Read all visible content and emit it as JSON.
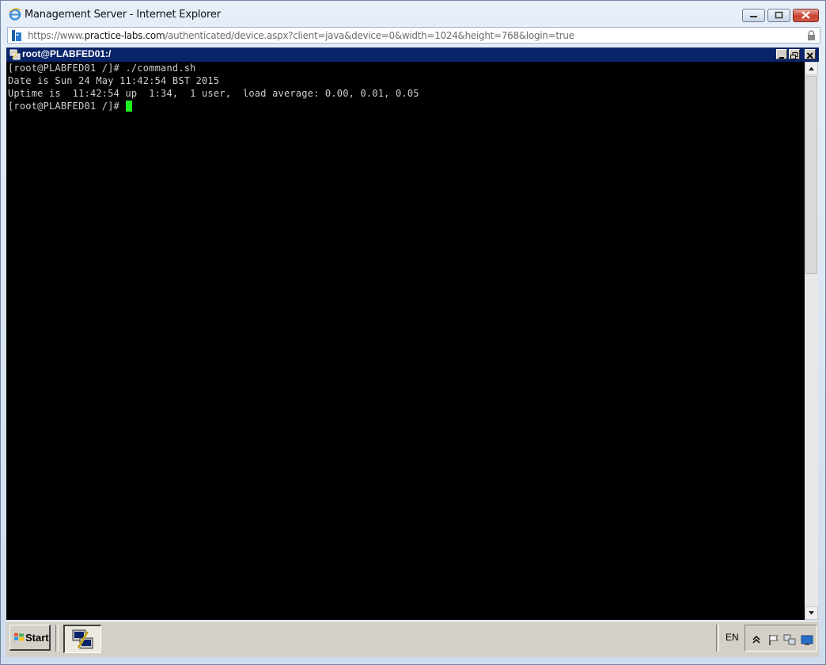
{
  "browser": {
    "title": "Management Server - Internet Explorer",
    "url_scheme": "https://www.",
    "url_host": "practice-labs.com",
    "url_path": "/authenticated/device.aspx?client=java&device=0&width=1024&height=768&login=true"
  },
  "remote_window": {
    "title": "root@PLABFED01:/"
  },
  "terminal": {
    "lines": [
      "[root@PLABFED01 /]# ./command.sh",
      "Date is Sun 24 May 11:42:54 BST 2015",
      "Uptime is  11:42:54 up  1:34,  1 user,  load average: 0.00, 0.01, 0.05",
      "[root@PLABFED01 /]# "
    ],
    "cursor_color": "#1ef01e"
  },
  "taskbar": {
    "start_label": "Start",
    "language": "EN"
  },
  "colors": {
    "inner_title_bg": "#0a246a",
    "terminal_bg": "#000000",
    "terminal_fg": "#cfcfcf"
  }
}
